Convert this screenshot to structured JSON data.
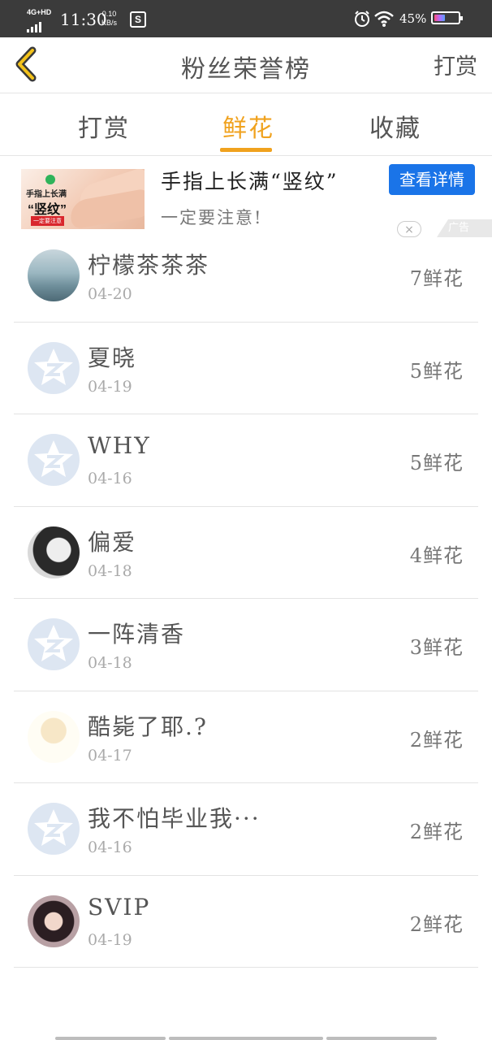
{
  "status_bar": {
    "network": "4G+HD",
    "time": "11:30",
    "speed_value": "0.10",
    "speed_unit": "KB/s",
    "battery_percent": "45%",
    "battery_level": 0.45,
    "icons": [
      "signal-icon",
      "s-app-icon",
      "alarm-icon",
      "wifi-icon",
      "battery-icon"
    ]
  },
  "header": {
    "back_icon": "chevron-left-icon",
    "title": "粉丝荣誉榜",
    "right_action": "打赏"
  },
  "tabs": {
    "items": [
      {
        "label": "打赏",
        "active": false
      },
      {
        "label": "鲜花",
        "active": true
      },
      {
        "label": "收藏",
        "active": false
      }
    ],
    "active_color": "#f0a21e"
  },
  "ad": {
    "image_text_line1": "手指上长满",
    "image_text_line2": "“竖纹”",
    "image_text_line3": "一定要注意",
    "title": "手指上长满“竖纹”",
    "subtitle": "一定要注意!",
    "button_label": "查看详情",
    "button_color": "#1a74e8",
    "close_icon": "×",
    "tag": "广告"
  },
  "fans": [
    {
      "name": "柠檬茶茶茶",
      "date": "04-20",
      "count": "7鲜花",
      "avatar": "lake"
    },
    {
      "name": "夏晓",
      "date": "04-19",
      "count": "5鲜花",
      "avatar": "default"
    },
    {
      "name": "WHY",
      "date": "04-16",
      "count": "5鲜花",
      "avatar": "default"
    },
    {
      "name": "偏爱",
      "date": "04-18",
      "count": "4鲜花",
      "avatar": "girl"
    },
    {
      "name": "一阵清香",
      "date": "04-18",
      "count": "3鲜花",
      "avatar": "default"
    },
    {
      "name": "酷毙了耶.?",
      "date": "04-17",
      "count": "2鲜花",
      "avatar": "cartoon"
    },
    {
      "name": "我不怕毕业我···",
      "date": "04-16",
      "count": "2鲜花",
      "avatar": "default"
    },
    {
      "name": "SVIP",
      "date": "04-19",
      "count": "2鲜花",
      "avatar": "svip"
    }
  ]
}
